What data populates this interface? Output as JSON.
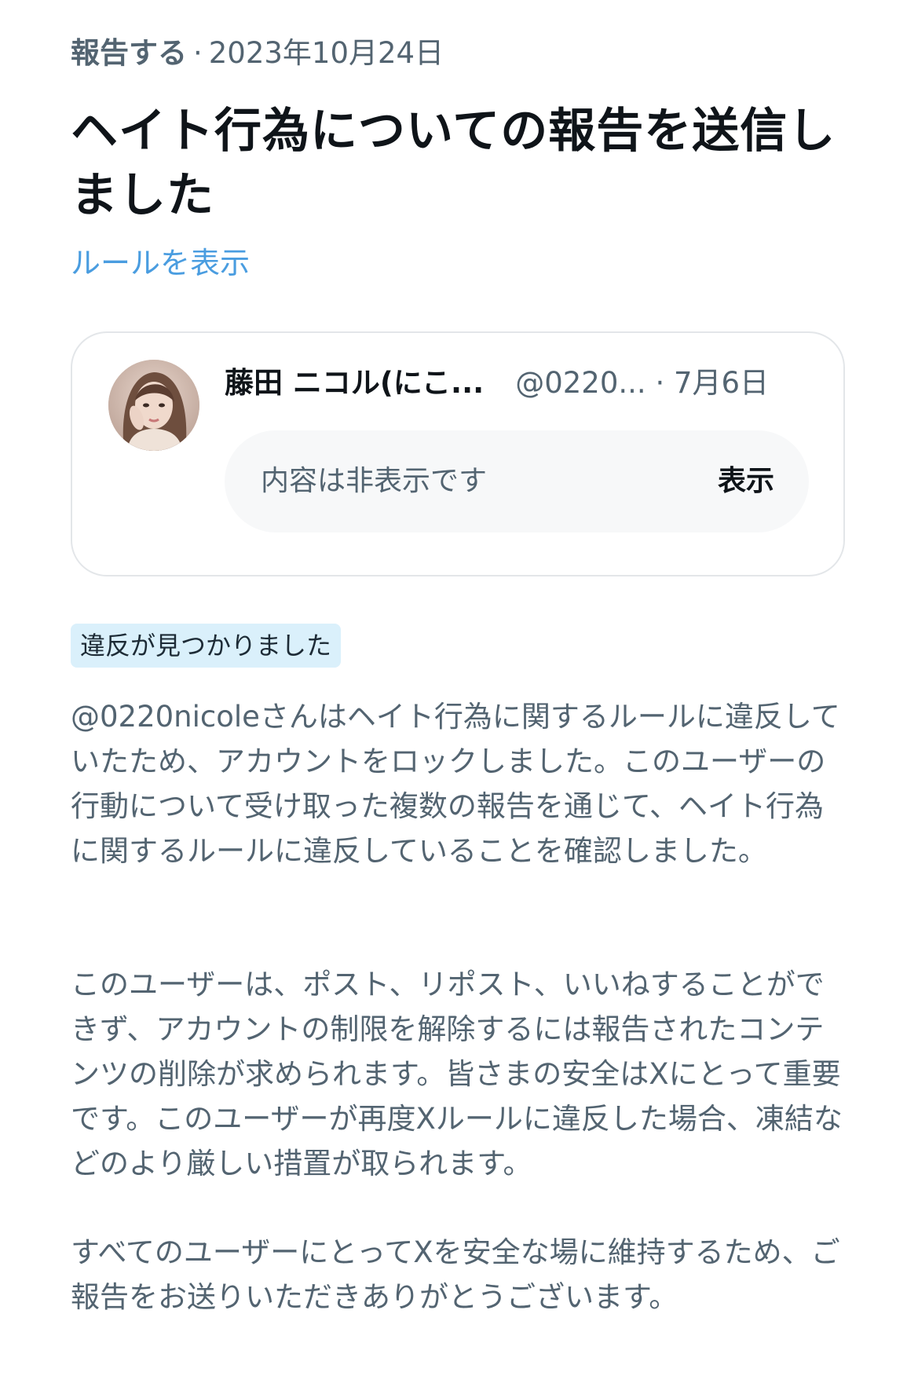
{
  "header": {
    "source": "報告する",
    "separator": "·",
    "date": "2023年10月24日"
  },
  "title": "ヘイト行為についての報告を送信しました",
  "rules_link": "ルールを表示",
  "post": {
    "author": "藤田 ニコル(にこ...",
    "handle": "@0220...",
    "date": "· 7月6日",
    "hidden_text": "内容は非表示です",
    "show_label": "表示"
  },
  "badge": "違反が見つかりました",
  "paragraphs": [
    "@0220nicoleさんはヘイト行為に関するルールに違反していたため、アカウントをロックしました。このユーザーの行動について受け取った複数の報告を通じて、ヘイト行為に関するルールに違反していることを確認しました。",
    "このユーザーは、ポスト、リポスト、いいねすることができず、アカウントの制限を解除するには報告されたコンテンツの削除が求められます。皆さまの安全はXにとって重要です。このユーザーが再度Xルールに違反した場合、凍結などのより厳しい措置が取られます。",
    "すべてのユーザーにとってXを安全な場に維持するため、ご報告をお送りいただきありがとうございます。"
  ]
}
